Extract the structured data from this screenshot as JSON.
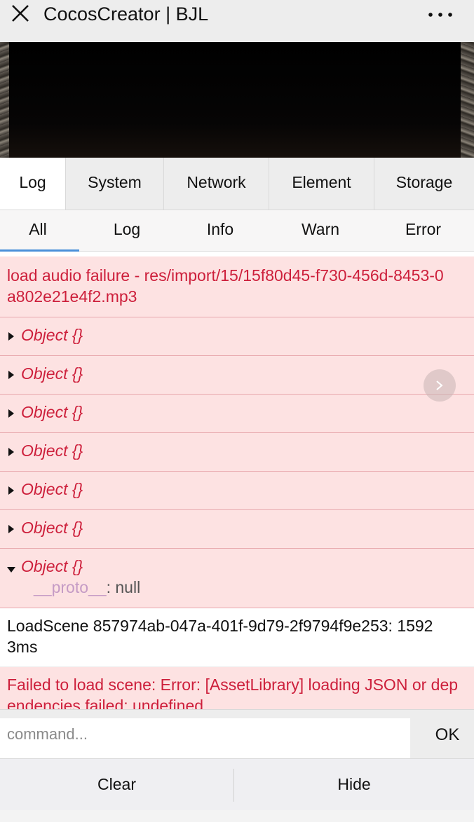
{
  "header": {
    "title": "CocosCreator | BJL",
    "close_icon": "close-icon",
    "more_icon": "more-icon"
  },
  "console_tabs": [
    {
      "label": "Log",
      "active": true
    },
    {
      "label": "System",
      "active": false
    },
    {
      "label": "Network",
      "active": false
    },
    {
      "label": "Element",
      "active": false
    },
    {
      "label": "Storage",
      "active": false
    }
  ],
  "filters": [
    {
      "label": "All",
      "active": true
    },
    {
      "label": "Log",
      "active": false
    },
    {
      "label": "Info",
      "active": false
    },
    {
      "label": "Warn",
      "active": false
    },
    {
      "label": "Error",
      "active": false
    }
  ],
  "logs": {
    "audio_error": "load audio failure - res/import/15/15f80d45-f730-456d-8453-0a802e21e4f2.mp3",
    "object_label": "Object {}",
    "proto_key": "__proto__",
    "proto_sep": ": ",
    "proto_value": "null",
    "load_scene": "LoadScene 857974ab-047a-401f-9d79-2f9794f9e253: 15923ms",
    "scene_error": "Failed to load scene: Error: [AssetLibrary] loading JSON or dependencies failed: undefined"
  },
  "command": {
    "placeholder": "command...",
    "value": "",
    "ok_label": "OK"
  },
  "toolbar": {
    "clear_label": "Clear",
    "hide_label": "Hide"
  },
  "colors": {
    "error_bg": "#fde2e2",
    "error_text": "#cd1f3b",
    "tab_underline": "#4a90d9"
  }
}
